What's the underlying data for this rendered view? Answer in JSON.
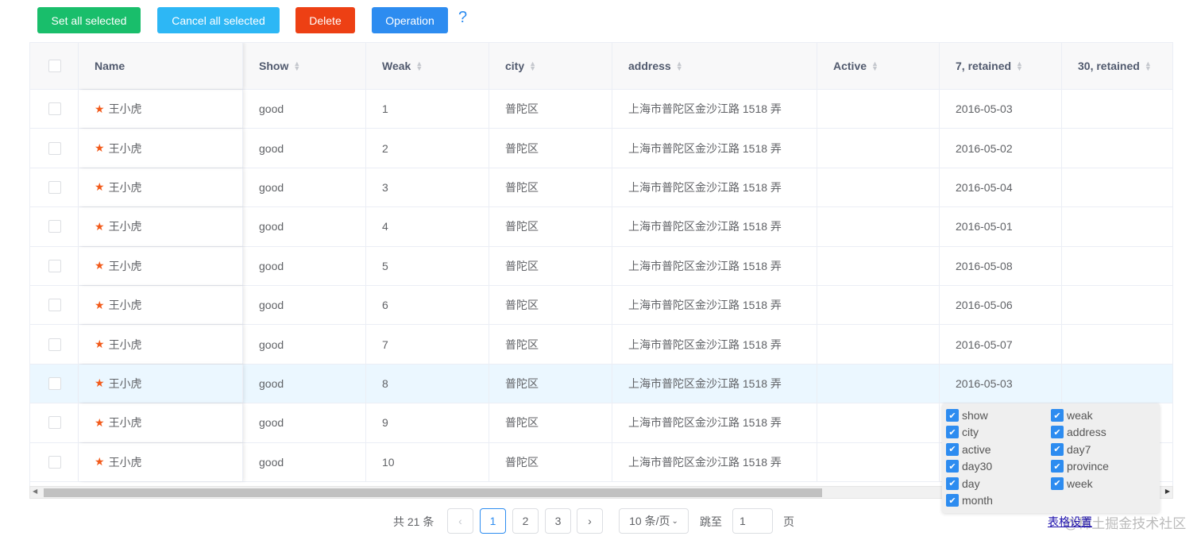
{
  "toolbar": {
    "set_all": "Set all selected",
    "cancel_all": "Cancel all selected",
    "delete": "Delete",
    "operation": "Operation",
    "help": "?"
  },
  "colors": {
    "green": "#19be6b",
    "cyan": "#2db7f5",
    "red": "#ed4014",
    "blue": "#2d8cf0"
  },
  "columns": [
    "Name",
    "Show",
    "Weak",
    "city",
    "address",
    "Active",
    "7, retained",
    "30, retained"
  ],
  "rows": [
    {
      "name": "王小虎",
      "show": "good",
      "weak": "1",
      "city": "普陀区",
      "address": "上海市普陀区金沙江路 1518 弄",
      "active": "",
      "day7": "2016-05-03",
      "day30": ""
    },
    {
      "name": "王小虎",
      "show": "good",
      "weak": "2",
      "city": "普陀区",
      "address": "上海市普陀区金沙江路 1518 弄",
      "active": "",
      "day7": "2016-05-02",
      "day30": ""
    },
    {
      "name": "王小虎",
      "show": "good",
      "weak": "3",
      "city": "普陀区",
      "address": "上海市普陀区金沙江路 1518 弄",
      "active": "",
      "day7": "2016-05-04",
      "day30": ""
    },
    {
      "name": "王小虎",
      "show": "good",
      "weak": "4",
      "city": "普陀区",
      "address": "上海市普陀区金沙江路 1518 弄",
      "active": "",
      "day7": "2016-05-01",
      "day30": ""
    },
    {
      "name": "王小虎",
      "show": "good",
      "weak": "5",
      "city": "普陀区",
      "address": "上海市普陀区金沙江路 1518 弄",
      "active": "",
      "day7": "2016-05-08",
      "day30": ""
    },
    {
      "name": "王小虎",
      "show": "good",
      "weak": "6",
      "city": "普陀区",
      "address": "上海市普陀区金沙江路 1518 弄",
      "active": "",
      "day7": "2016-05-06",
      "day30": ""
    },
    {
      "name": "王小虎",
      "show": "good",
      "weak": "7",
      "city": "普陀区",
      "address": "上海市普陀区金沙江路 1518 弄",
      "active": "",
      "day7": "2016-05-07",
      "day30": ""
    },
    {
      "name": "王小虎",
      "show": "good",
      "weak": "8",
      "city": "普陀区",
      "address": "上海市普陀区金沙江路 1518 弄",
      "active": "",
      "day7": "2016-05-03",
      "day30": ""
    },
    {
      "name": "王小虎",
      "show": "good",
      "weak": "9",
      "city": "普陀区",
      "address": "上海市普陀区金沙江路 1518 弄",
      "active": "",
      "day7": "",
      "day30": ""
    },
    {
      "name": "王小虎",
      "show": "good",
      "weak": "10",
      "city": "普陀区",
      "address": "上海市普陀区金沙江路 1518 弄",
      "active": "",
      "day7": "",
      "day30": ""
    }
  ],
  "column_settings": {
    "options": [
      "show",
      "weak",
      "city",
      "address",
      "active",
      "day7",
      "day30",
      "province",
      "day",
      "week",
      "month"
    ],
    "link": "表格设置"
  },
  "pagination": {
    "total": "共 21 条",
    "prev": "‹",
    "pages": [
      "1",
      "2",
      "3"
    ],
    "current": "1",
    "next": "›",
    "page_size": "10 条/页",
    "jump_label": "跳至",
    "jump_value": "1",
    "page_suffix": "页"
  },
  "watermark": "@稀土掘金技术社区"
}
